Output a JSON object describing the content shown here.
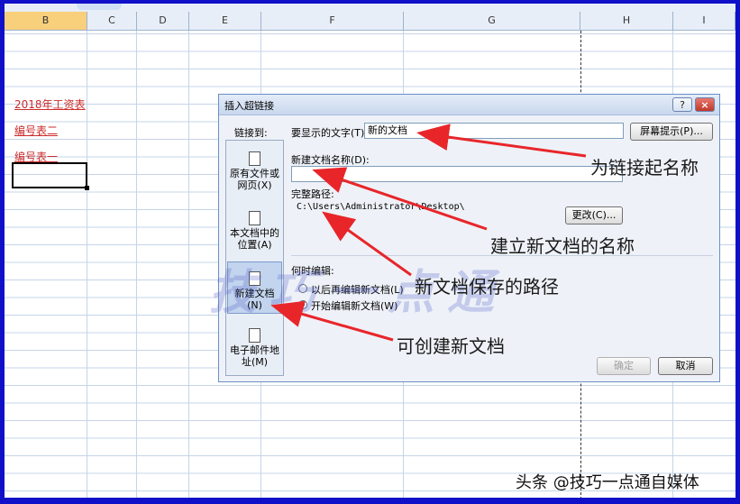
{
  "sheet": {
    "columns": [
      "B",
      "C",
      "D",
      "E",
      "F",
      "G",
      "H",
      "I"
    ],
    "cells": [
      "2018年工资表",
      "编号表二",
      "编号表一"
    ]
  },
  "dialog": {
    "title": "插入超链接",
    "help_label": "?",
    "close_label": "×",
    "link_to_label": "链接到:",
    "display_text_label": "要显示的文字(T):",
    "display_text_value": "新的文档",
    "screen_tip_label": "屏幕提示(P)...",
    "new_doc_name_label": "新建文档名称(D):",
    "new_doc_name_value": "",
    "full_path_label": "完整路径:",
    "full_path_value": "C:\\Users\\Administrator\\Desktop\\",
    "change_label": "更改(C)...",
    "when_edit_label": "何时编辑:",
    "edit_later": "以后再编辑新文档(L)",
    "edit_now": "开始编辑新文档(W)",
    "ok_label": "确定",
    "cancel_label": "取消",
    "sidebar": [
      {
        "label": "原有文件或网页(X)",
        "icon": "globe-file-icon"
      },
      {
        "label": "本文档中的位置(A)",
        "icon": "document-place-icon"
      },
      {
        "label": "新建文档(N)",
        "icon": "new-document-icon",
        "selected": true
      },
      {
        "label": "电子邮件地址(M)",
        "icon": "email-icon"
      }
    ]
  },
  "annotations": {
    "name_link": "为链接起名称",
    "new_doc_name": "建立新文档的名称",
    "save_path": "新文档保存的路径",
    "can_create": "可创建新文档"
  },
  "watermark": "技巧一点通",
  "credit": "头条 @技巧一点通自媒体",
  "colors": {
    "border": "#1010c8",
    "arrow": "#e8262a",
    "link": "#cc2c2c"
  }
}
